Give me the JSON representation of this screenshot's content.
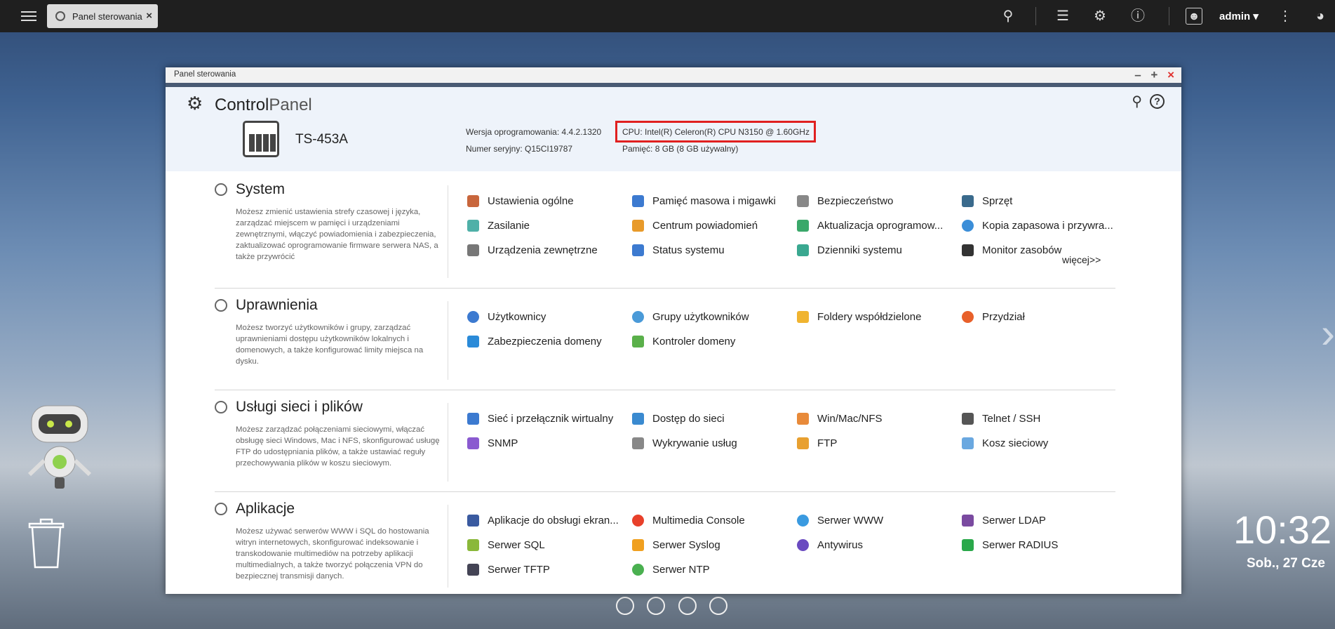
{
  "taskbar": {
    "tab_label": "Panel sterowania",
    "tab_close": "×",
    "user": "admin ▾"
  },
  "window": {
    "title": "Panel sterowania",
    "ctrl_min": "–",
    "ctrl_max": "+",
    "ctrl_close": "×"
  },
  "header": {
    "title_bold": "Control",
    "title_light": "Panel",
    "model": "TS-453A",
    "fw_label": "Wersja oprogramowania:",
    "fw_value": "4.4.2.1320",
    "sn_label": "Numer seryjny:",
    "sn_value": "Q15CI19787",
    "cpu_label": "CPU:",
    "cpu_value": "Intel(R) Celeron(R) CPU N3150 @ 1.60GHz",
    "mem_label": "Pamięć:",
    "mem_value": "8 GB (8 GB używalny)"
  },
  "sections": [
    {
      "title": "System",
      "desc": "Możesz zmienić ustawienia strefy czasowej i języka, zarządzać miejscem w pamięci i urządzeniami zewnętrznymi, włączyć powiadomienia i zabezpieczenia, zaktualizować oprogramowanie firmware serwera NAS, a także przywrócić",
      "items": [
        "Ustawienia ogólne",
        "Pamięć masowa i migawki",
        "Bezpieczeństwo",
        "Sprzęt",
        "Zasilanie",
        "Centrum powiadomień",
        "Aktualizacja oprogramow...",
        "Kopia zapasowa i przywra...",
        "Urządzenia zewnętrzne",
        "Status systemu",
        "Dzienniki systemu",
        "Monitor zasobów"
      ],
      "more": "więcej>>"
    },
    {
      "title": "Uprawnienia",
      "desc": "Możesz tworzyć użytkowników i grupy, zarządzać uprawnieniami dostępu użytkowników lokalnych i domenowych, a także konfigurować limity miejsca na dysku.",
      "items": [
        "Użytkownicy",
        "Grupy użytkowników",
        "Foldery współdzielone",
        "Przydział",
        "Zabezpieczenia domeny",
        "Kontroler domeny"
      ]
    },
    {
      "title": "Usługi sieci i plików",
      "desc": "Możesz zarządzać połączeniami sieciowymi, włączać obsługę sieci Windows, Mac i NFS, skonfigurować usługę FTP do udostępniania plików, a także ustawiać reguły przechowywania plików w koszu sieciowym.",
      "items": [
        "Sieć i przełącznik wirtualny",
        "Dostęp do sieci",
        "Win/Mac/NFS",
        "Telnet / SSH",
        "SNMP",
        "Wykrywanie usług",
        "FTP",
        "Kosz sieciowy"
      ]
    },
    {
      "title": "Aplikacje",
      "desc": "Możesz używać serwerów WWW i SQL do hostowania witryn internetowych, skonfigurować indeksowanie i transkodowanie multimediów na potrzeby aplikacji multimedialnych, a także tworzyć połączenia VPN do bezpiecznej transmisji danych.",
      "items": [
        "Aplikacje do obsługi ekran...",
        "Multimedia Console",
        "Serwer WWW",
        "Serwer LDAP",
        "Serwer SQL",
        "Serwer Syslog",
        "Antywirus",
        "Serwer RADIUS",
        "Serwer TFTP",
        "Serwer NTP"
      ]
    }
  ],
  "desktop": {
    "time": "10:32",
    "date": "Sob., 27 Cze"
  },
  "colors": {
    "accent": "#e02020",
    "taskbar": "#1f1f1f",
    "header_bg": "#eef3fa"
  }
}
